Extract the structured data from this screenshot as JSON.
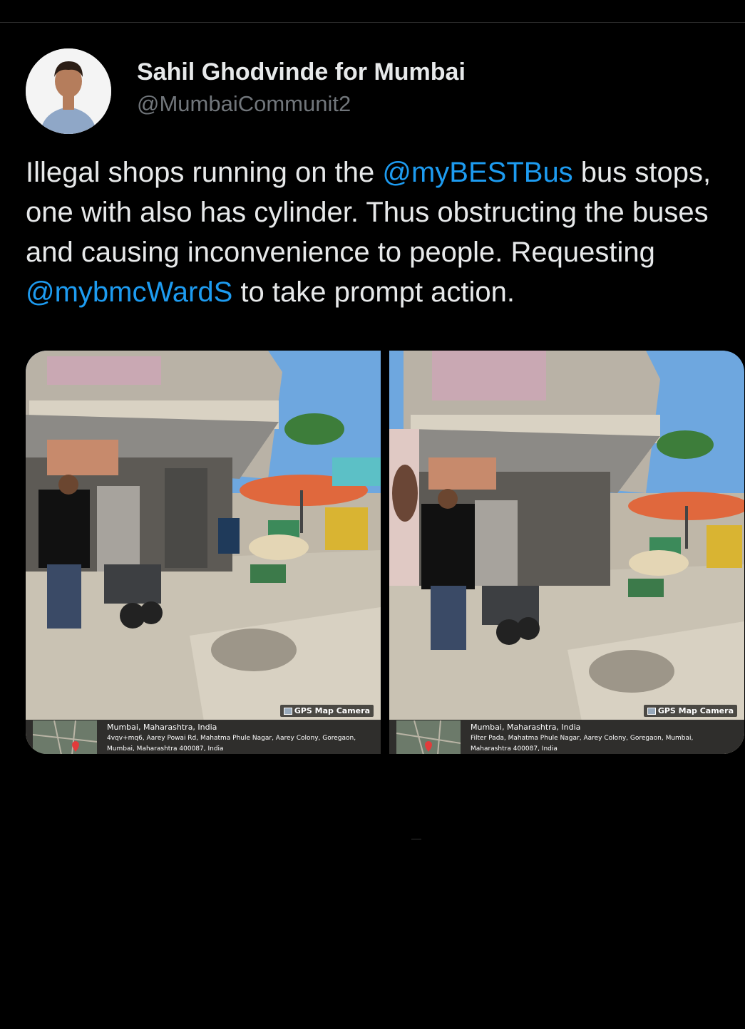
{
  "tweet": {
    "author": {
      "name": "Sahil Ghodvinde for Mumbai",
      "handle": "@MumbaiCommunit2"
    },
    "text_segments": [
      {
        "text": "Illegal shops running on the ",
        "type": "text"
      },
      {
        "text": "@myBESTBus",
        "type": "mention"
      },
      {
        "text": " bus stops, one with also has cylinder. Thus obstructing the buses and causing inconvenience to people. Requesting ",
        "type": "text"
      },
      {
        "text": "@mybmcWardS",
        "type": "mention"
      },
      {
        "text": " to take prompt action.",
        "type": "text"
      }
    ],
    "photos": [
      {
        "badge": "GPS Map Camera",
        "location_title": "Mumbai, Maharashtra, India",
        "address_line1": "4vqv+mq6, Aarey Powai Rd, Mahatma Phule Nagar, Aarey Colony, Goregaon,",
        "address_line2": "Mumbai, Maharashtra 400087, India"
      },
      {
        "badge": "GPS Map Camera",
        "location_title": "Mumbai, Maharashtra, India",
        "address_line1": "Filter Pada, Mahatma Phule Nagar, Aarey Colony, Goregaon, Mumbai,",
        "address_line2": "Maharashtra 400087, India"
      }
    ]
  },
  "colors": {
    "background": "#000000",
    "text": "#e7e9ea",
    "secondary": "#71767b",
    "mention": "#1d9bf0"
  },
  "icons": [
    "avatar-photo",
    "camera-icon",
    "map-pin-icon"
  ]
}
